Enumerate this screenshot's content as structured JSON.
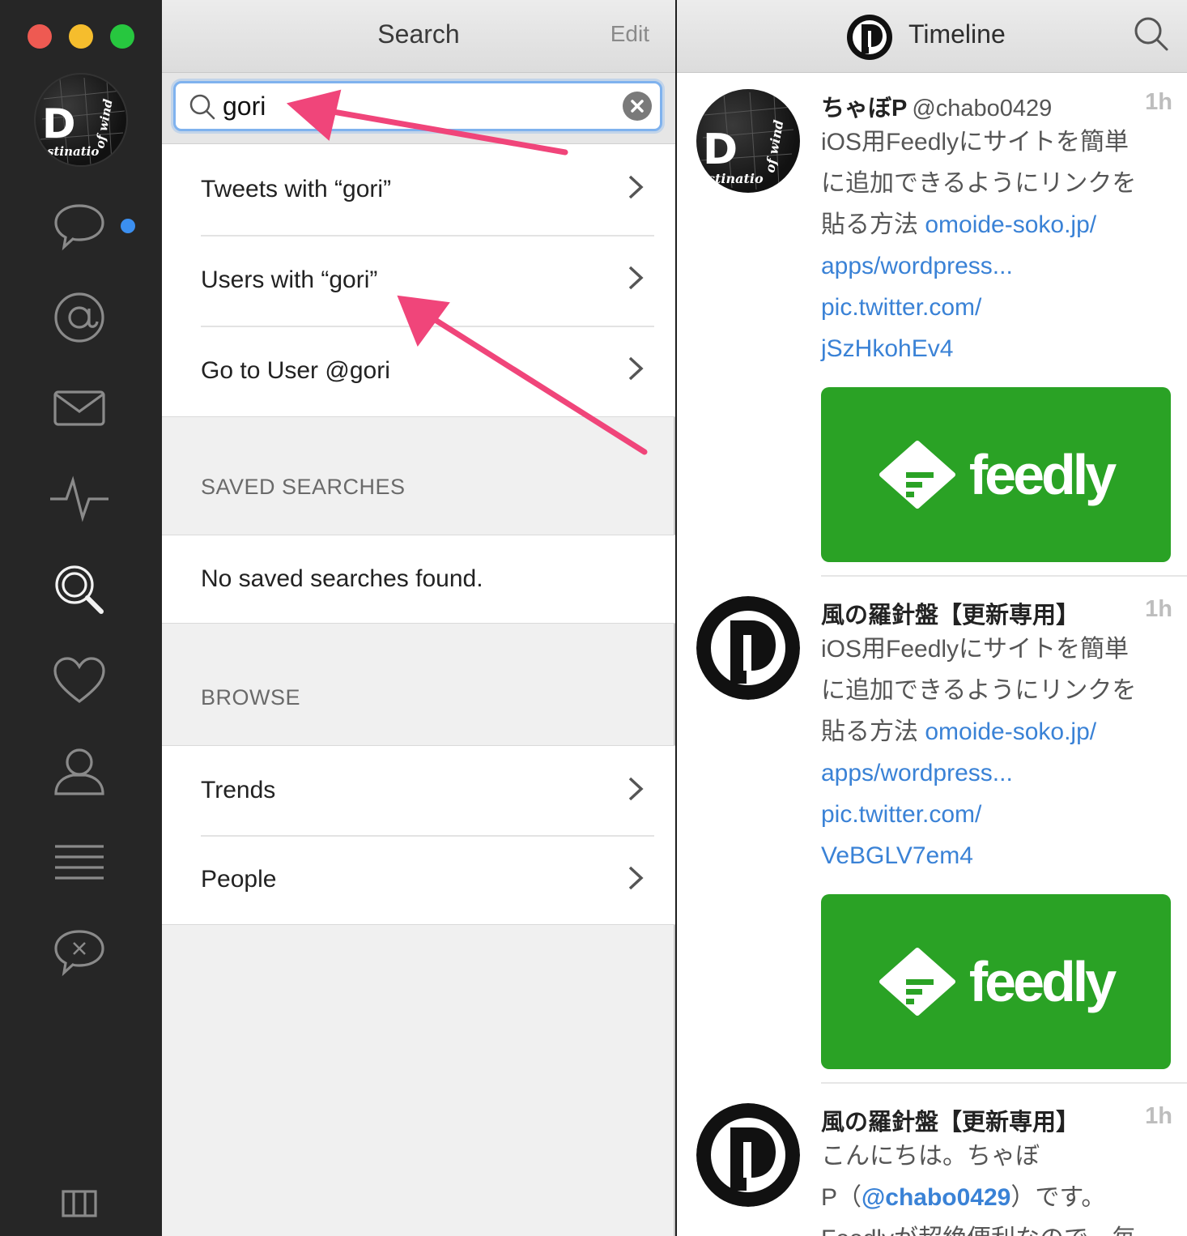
{
  "window": {
    "traffic_lights": {
      "close": "#ee5a52",
      "minimize": "#f5bd2d",
      "zoom": "#27c73f"
    }
  },
  "sidebar": {
    "items": [
      {
        "icon": "speech-bubble-icon",
        "has_unread": true
      },
      {
        "icon": "at-sign-icon"
      },
      {
        "icon": "envelope-icon"
      },
      {
        "icon": "activity-icon"
      },
      {
        "icon": "search-icon",
        "active": true
      },
      {
        "icon": "heart-icon"
      },
      {
        "icon": "user-icon"
      },
      {
        "icon": "list-icon"
      },
      {
        "icon": "muted-bubble-icon"
      }
    ],
    "footer_icon": "columns-icon"
  },
  "search": {
    "title": "Search",
    "edit_label": "Edit",
    "query": "gori",
    "results": [
      {
        "label": "Tweets with “gori”"
      },
      {
        "label": "Users with “gori”"
      },
      {
        "label": "Go to User @gori"
      }
    ],
    "saved_searches": {
      "header": "SAVED SEARCHES",
      "empty_text": "No saved searches found."
    },
    "browse": {
      "header": "BROWSE",
      "items": [
        {
          "label": "Trends"
        },
        {
          "label": "People"
        }
      ]
    }
  },
  "timeline": {
    "title": "Timeline",
    "tweets": [
      {
        "name": "ちゃぼP",
        "handle": "@chabo0429",
        "time": "1h",
        "text_lines": [
          "iOS用Feedlyにサイトを簡単",
          "に追加できるようにリンクを"
        ],
        "text_prefix": "貼る方法 ",
        "links": [
          "omoide-soko.jp/",
          "apps/wordpress...",
          "pic.twitter.com/",
          "jSzHkohEv4"
        ],
        "card_label": "feedly"
      },
      {
        "name": "風の羅針盤【更新専用】",
        "time": "1h",
        "text_lines": [
          "iOS用Feedlyにサイトを簡単",
          "に追加できるようにリンクを"
        ],
        "text_prefix": "貼る方法 ",
        "links": [
          "omoide-soko.jp/",
          "apps/wordpress...",
          "pic.twitter.com/",
          "VeBGLV7em4"
        ],
        "card_label": "feedly"
      },
      {
        "name": "風の羅針盤【更新専用】",
        "time": "1h",
        "text_line1": "こんにちは。ちゃぼ",
        "text_line2_prefix": "P（",
        "mention": "@chabo0429",
        "text_line2_suffix": "）です。",
        "text_line3": "Feedlyが超絶便利なので、毎"
      }
    ]
  },
  "colors": {
    "accent": "#3a82d6",
    "annotation_arrow": "#f0457a",
    "feedly_green": "#2aa225",
    "unread_dot": "#3b8ff0"
  }
}
